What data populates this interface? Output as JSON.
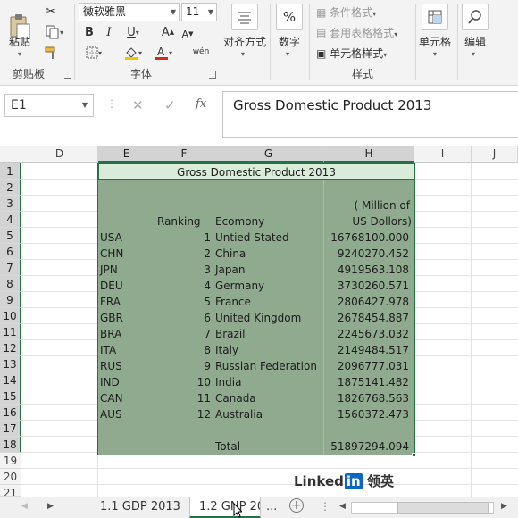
{
  "ribbon": {
    "clipboard": {
      "paste": "粘贴",
      "group": "剪贴板"
    },
    "font": {
      "name": "微软雅黑",
      "size": "11",
      "group": "字体",
      "bold": "B",
      "italic": "I",
      "underline": "U",
      "grow": "A",
      "shrink": "A",
      "wen": "wén"
    },
    "alignment": {
      "label": "对齐方式"
    },
    "number": {
      "label": "数字",
      "symbol": "%"
    },
    "styles": {
      "group": "样式",
      "conditional": "条件格式",
      "table": "套用表格格式",
      "cell": "单元格样式"
    },
    "cells": {
      "label": "单元格"
    },
    "editing": {
      "label": "编辑"
    }
  },
  "formula_bar": {
    "name_box": "E1",
    "cancel": "✕",
    "enter": "✓",
    "fx": "fx",
    "content": "Gross Domestic Product 2013"
  },
  "columns": [
    "D",
    "E",
    "F",
    "G",
    "H",
    "I",
    "J"
  ],
  "rows": [
    "1",
    "2",
    "3",
    "4",
    "5",
    "6",
    "7",
    "8",
    "9",
    "10",
    "11",
    "12",
    "13",
    "14",
    "15",
    "16",
    "17",
    "18",
    "19",
    "20",
    "21"
  ],
  "table": {
    "title": "Gross Domestic Product 2013",
    "unit_line1": "( Million of",
    "unit_line2": "US Dollors)",
    "ranking_header": "Ranking",
    "economy_header": "Ecomony",
    "rows": [
      {
        "code": "USA",
        "rank": "1",
        "name": "Untied Stated",
        "gdp": "16768100.000"
      },
      {
        "code": "CHN",
        "rank": "2",
        "name": "China",
        "gdp": "9240270.452"
      },
      {
        "code": "JPN",
        "rank": "3",
        "name": "Japan",
        "gdp": "4919563.108"
      },
      {
        "code": "DEU",
        "rank": "4",
        "name": "Germany",
        "gdp": "3730260.571"
      },
      {
        "code": "FRA",
        "rank": "5",
        "name": "France",
        "gdp": "2806427.978"
      },
      {
        "code": "GBR",
        "rank": "6",
        "name": "United Kingdom",
        "gdp": "2678454.887"
      },
      {
        "code": "BRA",
        "rank": "7",
        "name": "Brazil",
        "gdp": "2245673.032"
      },
      {
        "code": "ITA",
        "rank": "8",
        "name": "Italy",
        "gdp": "2149484.517"
      },
      {
        "code": "RUS",
        "rank": "9",
        "name": "Russian Federation",
        "gdp": "2096777.031"
      },
      {
        "code": "IND",
        "rank": "10",
        "name": "India",
        "gdp": "1875141.482"
      },
      {
        "code": "CAN",
        "rank": "11",
        "name": "Canada",
        "gdp": "1826768.563"
      },
      {
        "code": "AUS",
        "rank": "12",
        "name": "Australia",
        "gdp": "1560372.473"
      }
    ],
    "total_label": "Total",
    "total_value": "51897294.094"
  },
  "watermark": {
    "brand": "Linked",
    "in": "in",
    "cn": "领英"
  },
  "tabs": {
    "sheet1": "1.1 GDP 2013",
    "sheet2": "1.2 GNP 20",
    "more": "...",
    "add": "+"
  },
  "colors": {
    "accent": "#217346",
    "selection": "#8faa8f"
  }
}
